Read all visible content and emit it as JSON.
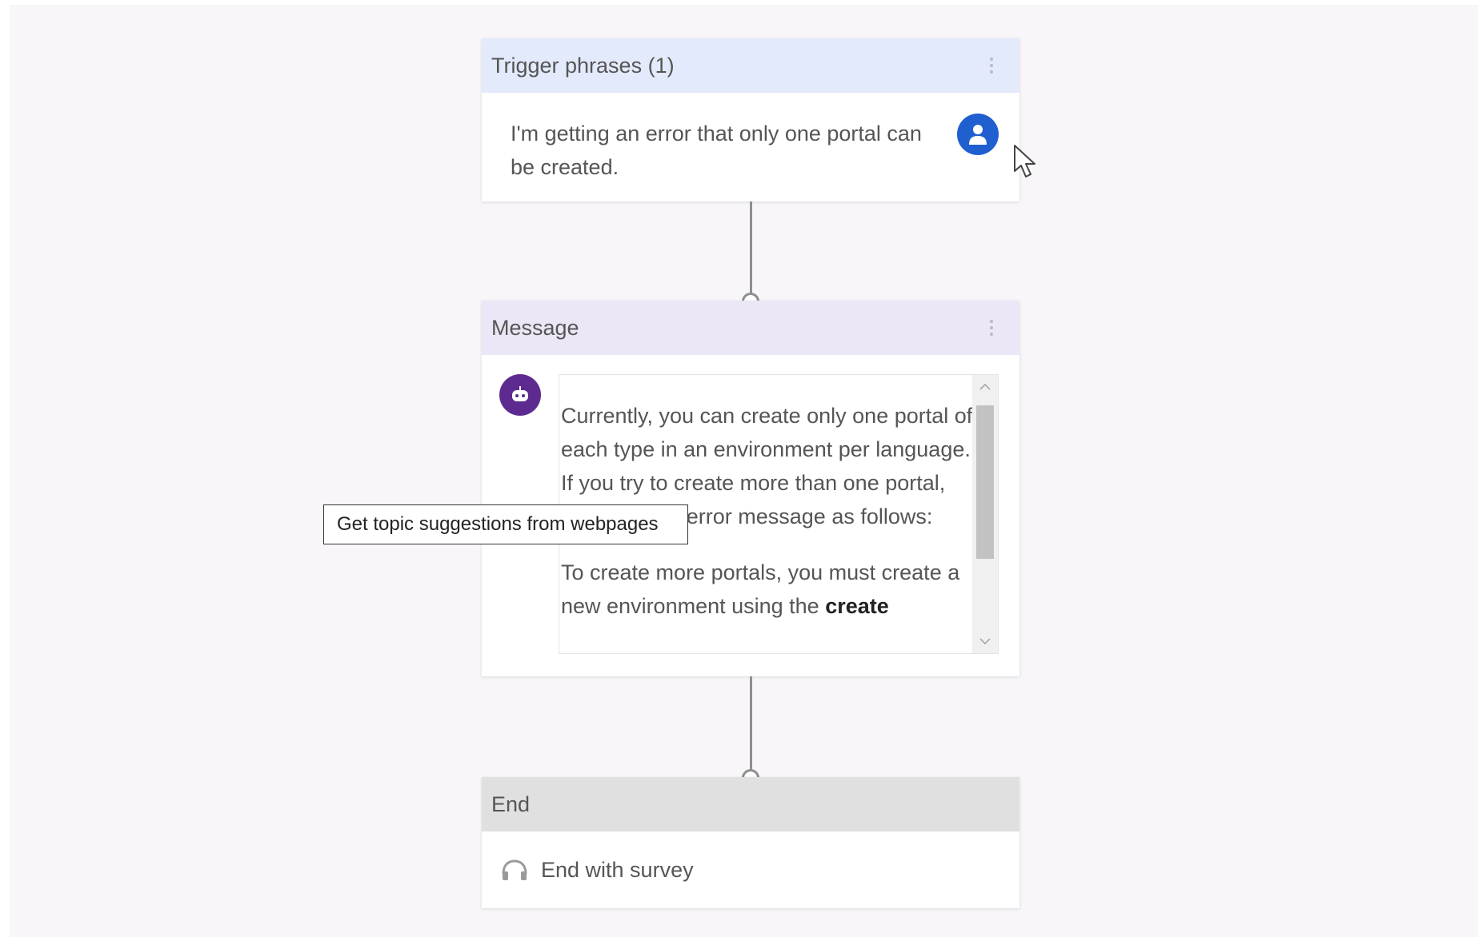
{
  "trigger": {
    "title": "Trigger phrases (1)",
    "phrase": "I'm getting an error that only one portal can be created.",
    "icon": "user-icon",
    "color": "#1f5fcf"
  },
  "message": {
    "title": "Message",
    "icon": "bot-icon",
    "color": "#5d2b8f",
    "paragraph1": "Currently, you can create only one portal of each type in an environment per language. If you try to create more than one portal, you'll see an error message as follows:",
    "paragraph2_prefix": "To create more portals, you must create a new environment using the ",
    "paragraph2_bold": "create"
  },
  "end": {
    "title": "End",
    "action_label": "End with survey",
    "icon": "survey-icon"
  },
  "tooltip": {
    "text": "Get topic suggestions from webpages"
  }
}
